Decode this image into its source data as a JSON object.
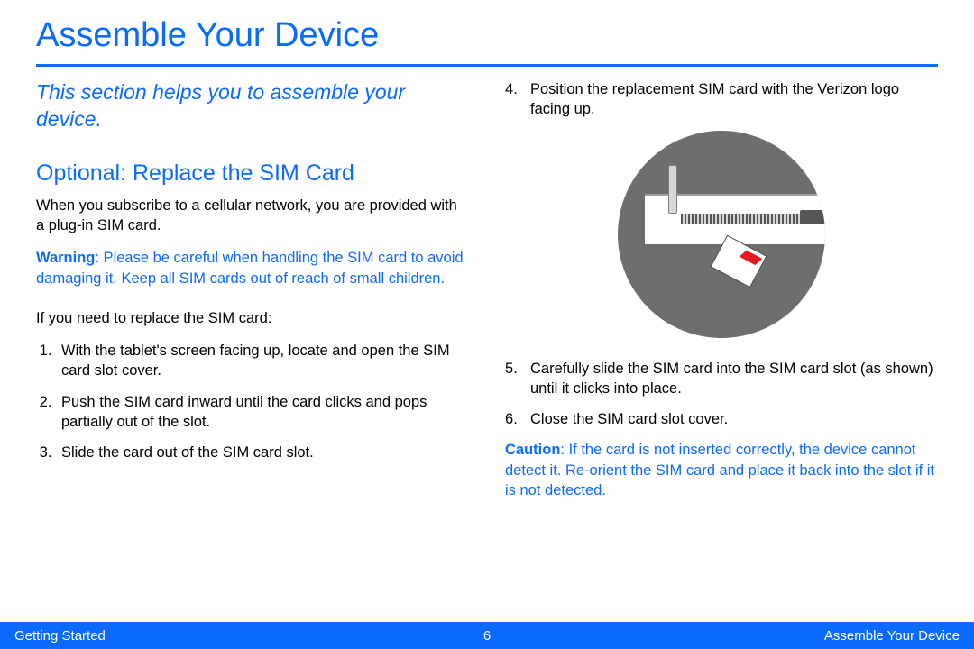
{
  "title": "Assemble Your Device",
  "intro": "This section helps you to assemble your device.",
  "subhead": "Optional: Replace the SIM Card",
  "lead": "When you subscribe to a cellular network, you are provided with a plug-in SIM card.",
  "warning_label": "Warning",
  "warning_text": ": Please be careful when handling the SIM card to avoid damaging it. Keep all SIM cards out of reach of small children.",
  "if_need": "If you need to replace the SIM card:",
  "steps_left": [
    "With the tablet's screen facing up, locate and open the SIM card slot cover.",
    "Push the SIM card inward until the card clicks and pops partially out of the slot.",
    "Slide the card out of the SIM card slot."
  ],
  "steps_right": [
    "Position the replacement SIM card with the Verizon logo facing up.",
    "Carefully slide the SIM card into the SIM card slot (as shown) until it clicks into place.",
    "Close the SIM card slot cover."
  ],
  "caution_label": "Caution",
  "caution_text": ": If the card is not inserted correctly, the device cannot detect it. Re-orient the SIM card and place it back into the slot if it is not detected.",
  "footer": {
    "left": "Getting Started",
    "page": "6",
    "right": "Assemble Your Device"
  }
}
